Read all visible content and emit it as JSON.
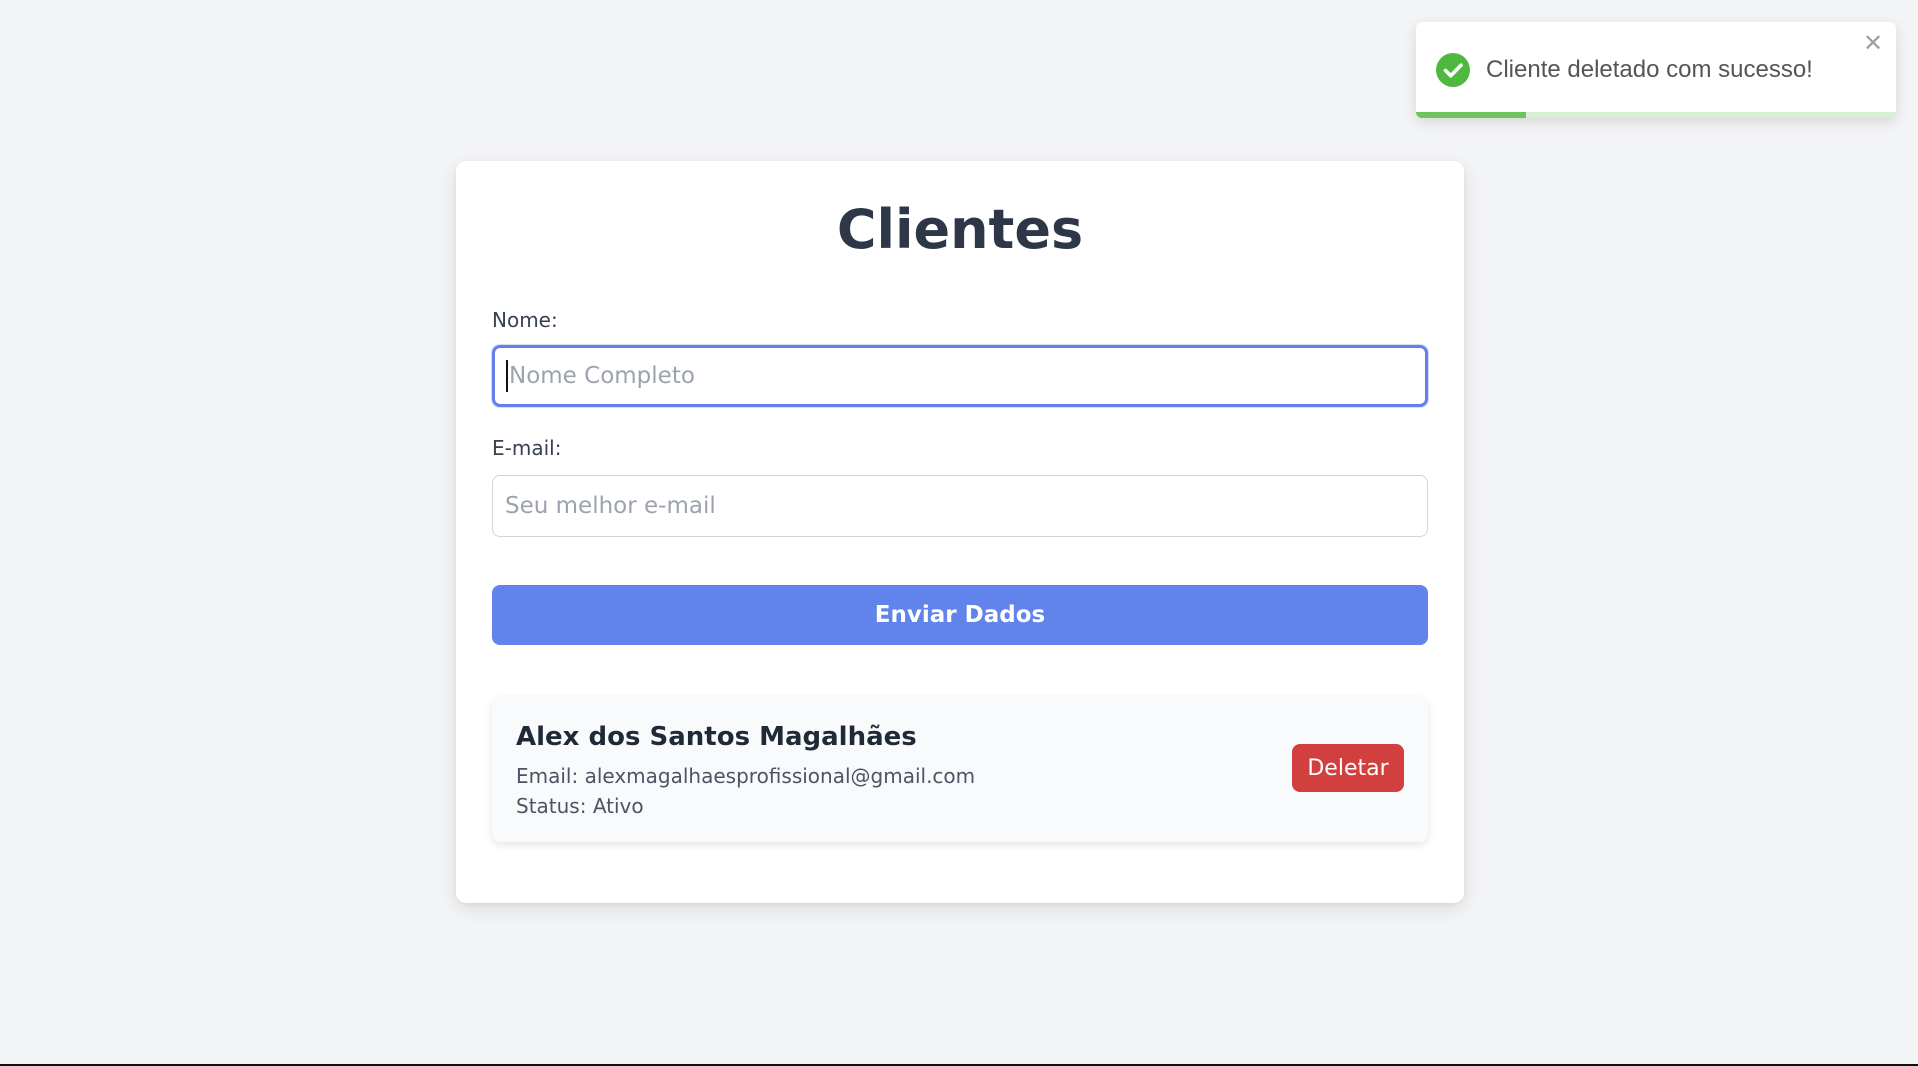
{
  "page": {
    "title": "Clientes"
  },
  "form": {
    "name_label": "Nome:",
    "name_placeholder": "Nome Completo",
    "name_value": "",
    "email_label": "E-mail:",
    "email_placeholder": "Seu melhor e-mail",
    "email_value": "",
    "submit_label": "Enviar Dados"
  },
  "clients": [
    {
      "name": "Alex dos Santos Magalhães",
      "email_line": "Email: alexmagalhaesprofissional@gmail.com",
      "status_line": "Status: Ativo",
      "delete_label": "Deletar"
    }
  ],
  "toast": {
    "message": "Cliente deletado com sucesso!",
    "icon": "check-circle-icon",
    "close_icon": "close-icon",
    "progress_fraction": 0.23,
    "color": "#4fb93f"
  },
  "colors": {
    "primary": "#6083ec",
    "focus_border": "#667eea",
    "danger": "#d1403f",
    "success": "#4fb93f",
    "background": "#f3f4f6"
  }
}
